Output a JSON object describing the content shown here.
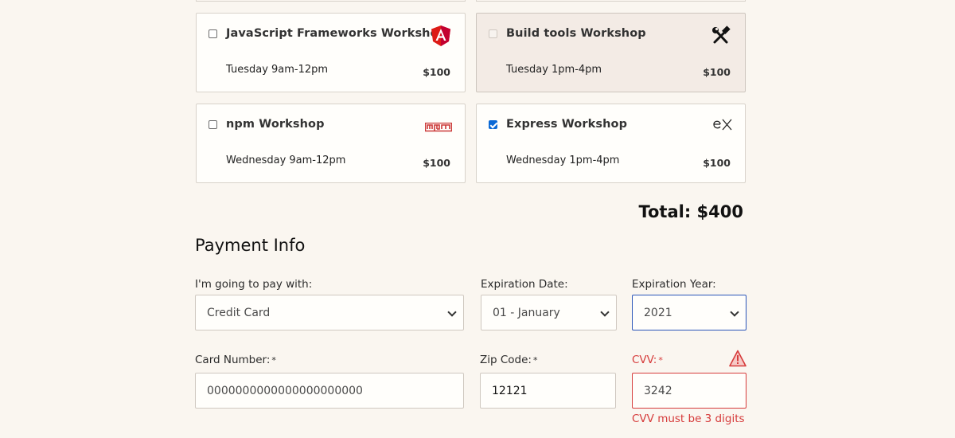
{
  "workshops": [
    {
      "title": "JavaScript Frameworks Workshop",
      "time": "Tuesday 9am-12pm",
      "price": "$100",
      "checked": false,
      "disabled": false,
      "icon": "angular-icon"
    },
    {
      "title": "Build tools Workshop",
      "time": "Tuesday 1pm-4pm",
      "price": "$100",
      "checked": false,
      "disabled": true,
      "icon": "tools-icon"
    },
    {
      "title": "npm Workshop",
      "time": "Wednesday 9am-12pm",
      "price": "$100",
      "checked": false,
      "disabled": false,
      "icon": "npm-icon"
    },
    {
      "title": "Express Workshop",
      "time": "Wednesday 1pm-4pm",
      "price": "$100",
      "checked": true,
      "disabled": false,
      "icon": "express-icon"
    }
  ],
  "total": "Total: $400",
  "payment": {
    "title": "Payment Info",
    "method_label": "I'm going to pay with:",
    "method_value": "Credit Card",
    "exp_date_label": "Expiration Date:",
    "exp_date_value": "01 - January",
    "exp_year_label": "Expiration Year:",
    "exp_year_value": "2021",
    "card_label": "Card Number:",
    "card_value": "0000000000000000000000",
    "zip_label": "Zip Code:",
    "zip_value": "12121",
    "cvv_label": "CVV:",
    "cvv_value": "3242",
    "cvv_error": "CVV must be 3 digits",
    "required_marker": "*"
  },
  "colors": {
    "error": "#d63b3b",
    "focus": "#2a55b8",
    "checkbox": "#0b69d6",
    "angular": "#dd1b16",
    "npm": "#cb3837"
  }
}
